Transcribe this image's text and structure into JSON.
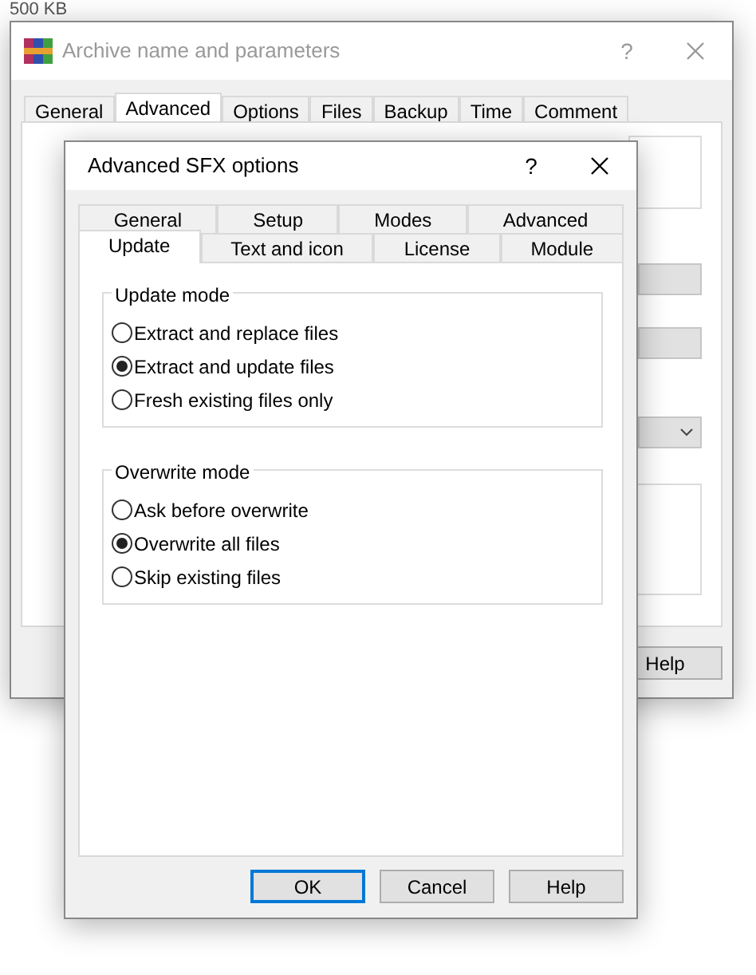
{
  "desktop_label": "500 KB",
  "main_window": {
    "title": "Archive name and parameters",
    "active": false,
    "help_glyph": "?",
    "tabs": [
      {
        "label": "General",
        "selected": false
      },
      {
        "label": "Advanced",
        "selected": true
      },
      {
        "label": "Options",
        "selected": false
      },
      {
        "label": "Files",
        "selected": false
      },
      {
        "label": "Backup",
        "selected": false
      },
      {
        "label": "Time",
        "selected": false
      },
      {
        "label": "Comment",
        "selected": false
      }
    ],
    "buttons": [
      "Help"
    ]
  },
  "dialog": {
    "title": "Advanced SFX options",
    "active": true,
    "help_glyph": "?",
    "tab_rows": [
      [
        {
          "label": "General",
          "selected": false
        },
        {
          "label": "Setup",
          "selected": false
        },
        {
          "label": "Modes",
          "selected": false
        },
        {
          "label": "Advanced",
          "selected": false
        }
      ],
      [
        {
          "label": "Update",
          "selected": true
        },
        {
          "label": "Text and icon",
          "selected": false
        },
        {
          "label": "License",
          "selected": false
        },
        {
          "label": "Module",
          "selected": false
        }
      ]
    ],
    "groups": [
      {
        "title": "Update mode",
        "options": [
          {
            "label": "Extract and replace files",
            "selected": false
          },
          {
            "label": "Extract and update files",
            "selected": true
          },
          {
            "label": "Fresh existing files only",
            "selected": false
          }
        ]
      },
      {
        "title": "Overwrite mode",
        "options": [
          {
            "label": "Ask before overwrite",
            "selected": false
          },
          {
            "label": "Overwrite all files",
            "selected": true
          },
          {
            "label": "Skip existing files",
            "selected": false
          }
        ]
      }
    ],
    "buttons": [
      {
        "label": "OK",
        "default": true
      },
      {
        "label": "Cancel",
        "default": false
      },
      {
        "label": "Help",
        "default": false
      }
    ]
  }
}
